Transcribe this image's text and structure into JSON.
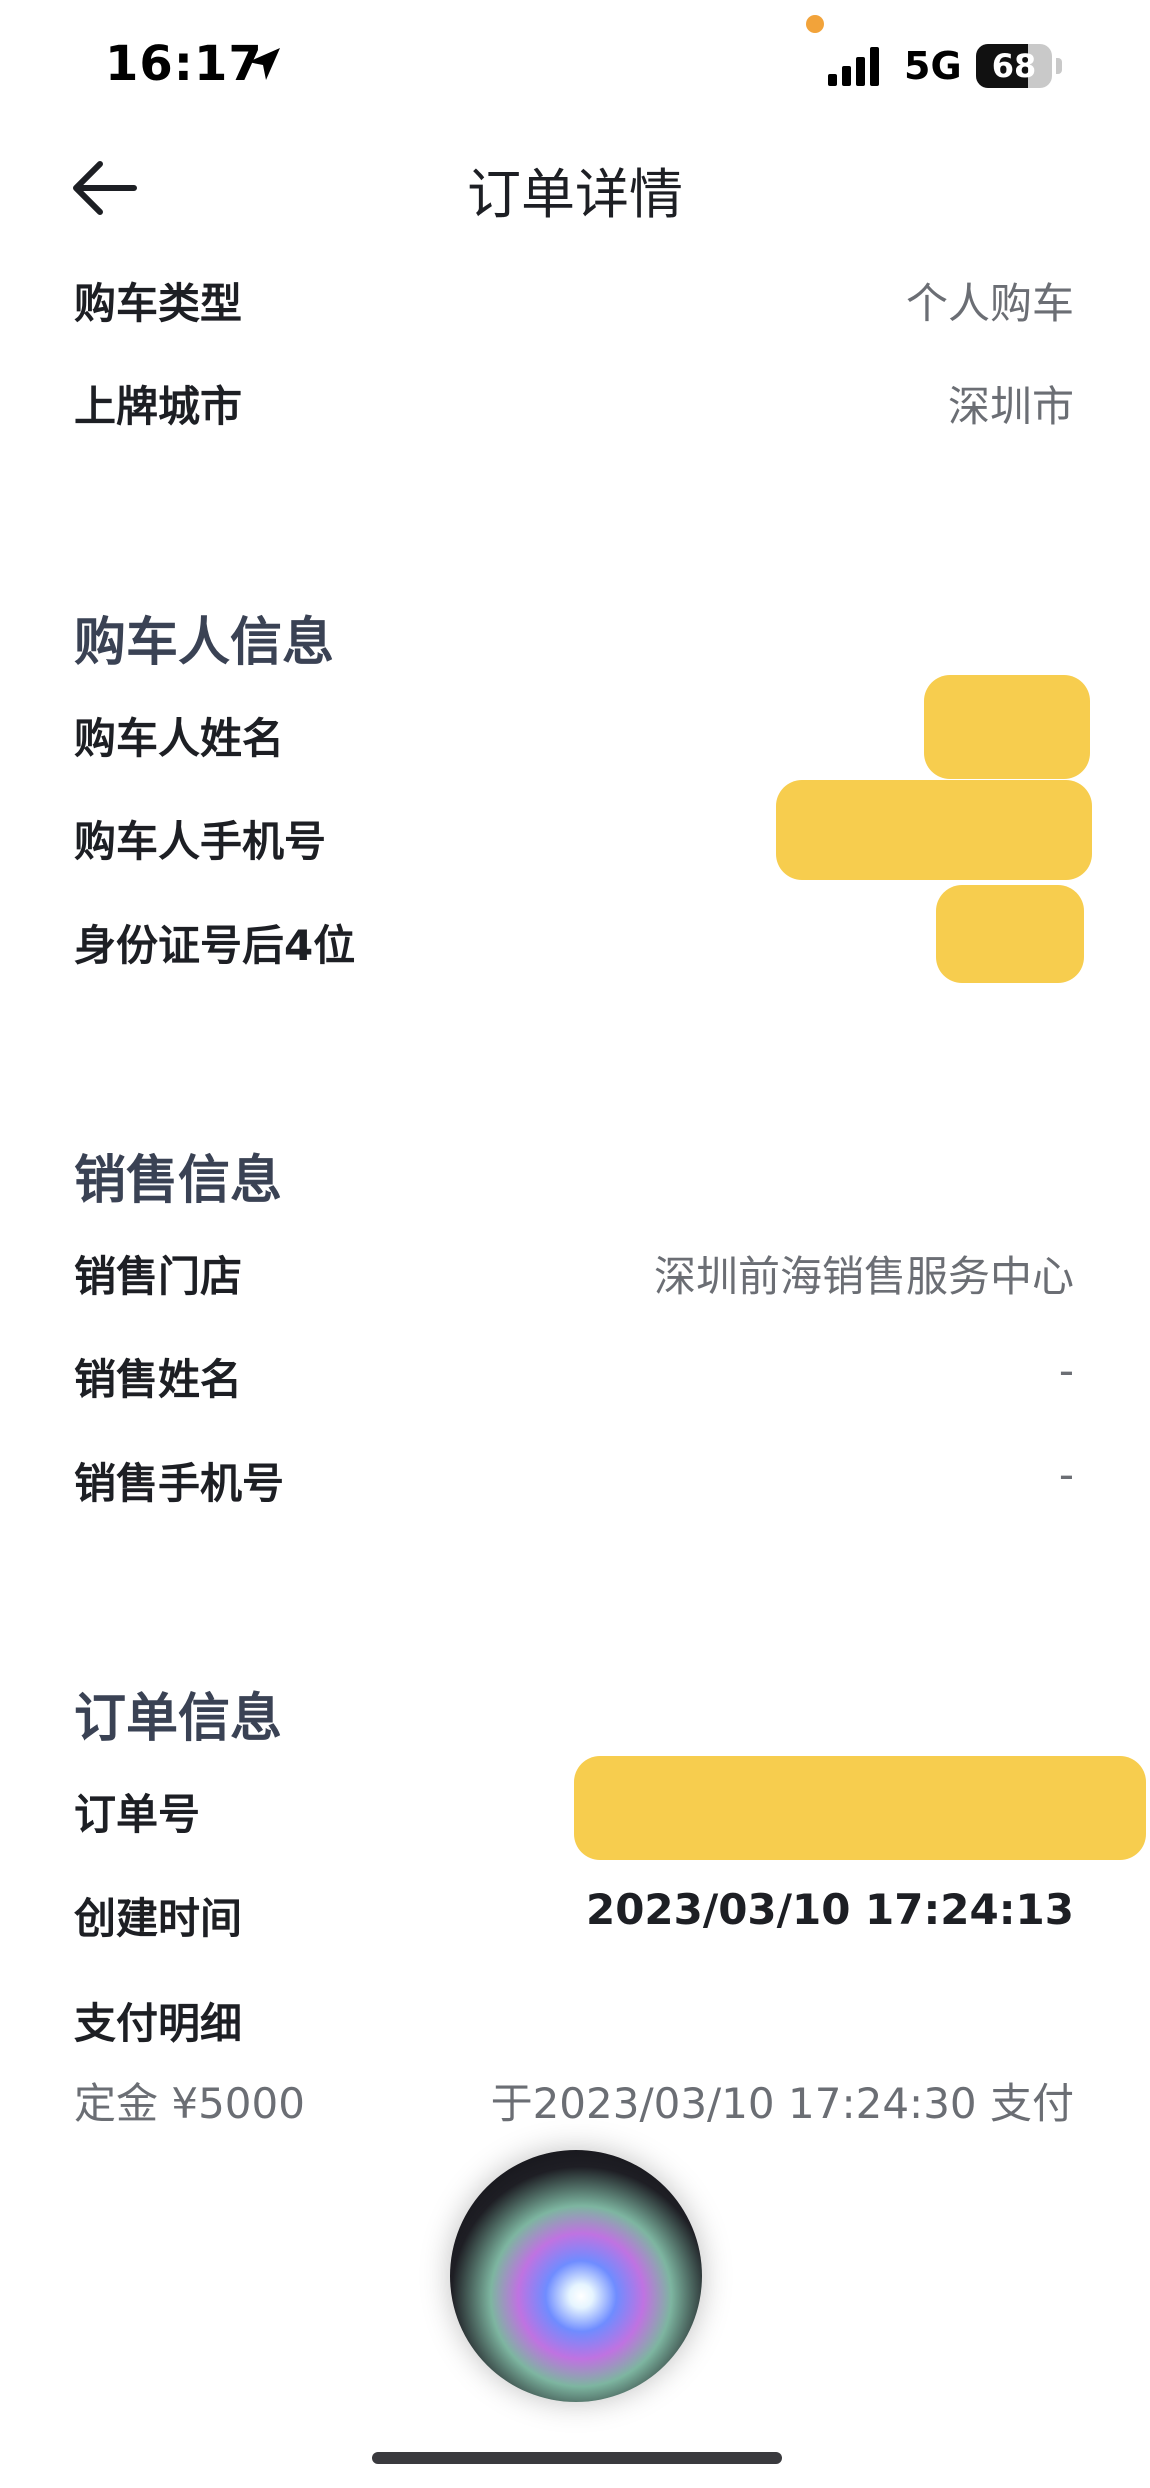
{
  "status_bar": {
    "time": "16:17",
    "network": "5G",
    "battery": "68",
    "battery_level": 0.68
  },
  "nav": {
    "title": "订单详情"
  },
  "vehicle": {
    "rows": [
      {
        "label": "购车类型",
        "value": "个人购车"
      },
      {
        "label": "上牌城市",
        "value": "深圳市"
      }
    ]
  },
  "buyer": {
    "title": "购车人信息",
    "rows": [
      {
        "label": "购车人姓名"
      },
      {
        "label": "购车人手机号"
      },
      {
        "label": "身份证号后4位"
      }
    ]
  },
  "sales": {
    "title": "销售信息",
    "rows": [
      {
        "label": "销售门店",
        "value": "深圳前海销售服务中心"
      },
      {
        "label": "销售姓名",
        "value": "-"
      },
      {
        "label": "销售手机号",
        "value": "-"
      }
    ]
  },
  "order": {
    "title": "订单信息",
    "order_no_label": "订单号",
    "created_label": "创建时间",
    "created_value": "2023/03/10 17:24:13",
    "payment_label": "支付明细",
    "deposit": "定金 ¥5000",
    "paid_at": "于2023/03/10 17:24:30 支付"
  },
  "colors": {
    "redaction": "#f7cd4e",
    "section_title": "#3a4254",
    "value_gray": "#6b6e74",
    "status_dot": "#f2a33a"
  }
}
